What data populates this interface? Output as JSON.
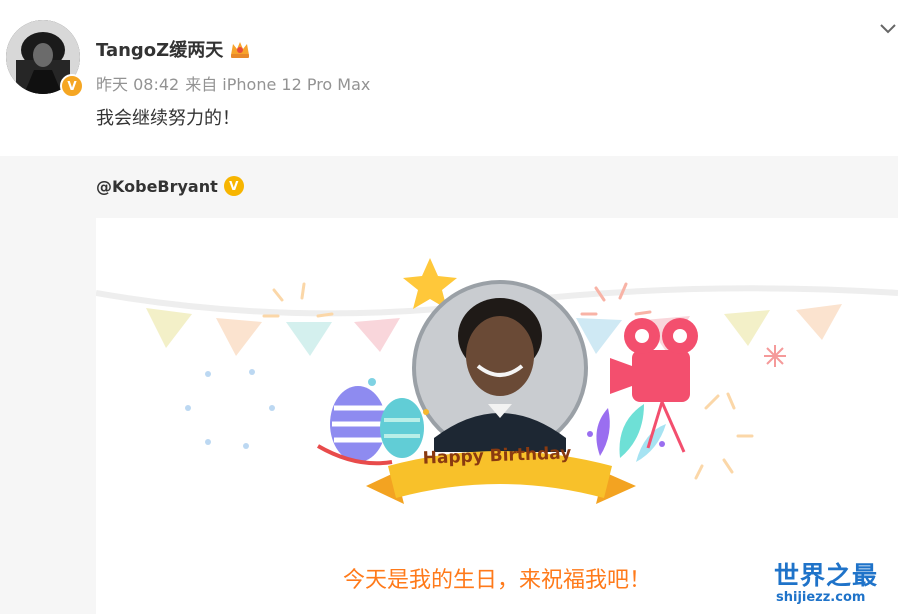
{
  "post": {
    "username": "TangoZ缓两天",
    "time": "昨天 08:42",
    "source": "来自 iPhone 12 Pro Max",
    "text": "我会继续努力的！",
    "verified_icon": "v-badge-icon",
    "member_icon": "crown-icon",
    "menu_icon": "chevron-down-icon"
  },
  "repost": {
    "author": "@KobeBryant",
    "verified_icon": "gold-v-icon",
    "card": {
      "banner_text": "Happy Birthday",
      "caption": "今天是我的生日，来祝福我吧！"
    }
  },
  "watermark": {
    "title": "世界之最",
    "url": "shijiezz.com"
  },
  "colors": {
    "caption": "#ff7a1a",
    "ribbon": "#f8c12a",
    "watermark": "#1f73c9",
    "repost_bg": "#f6f6f6"
  }
}
